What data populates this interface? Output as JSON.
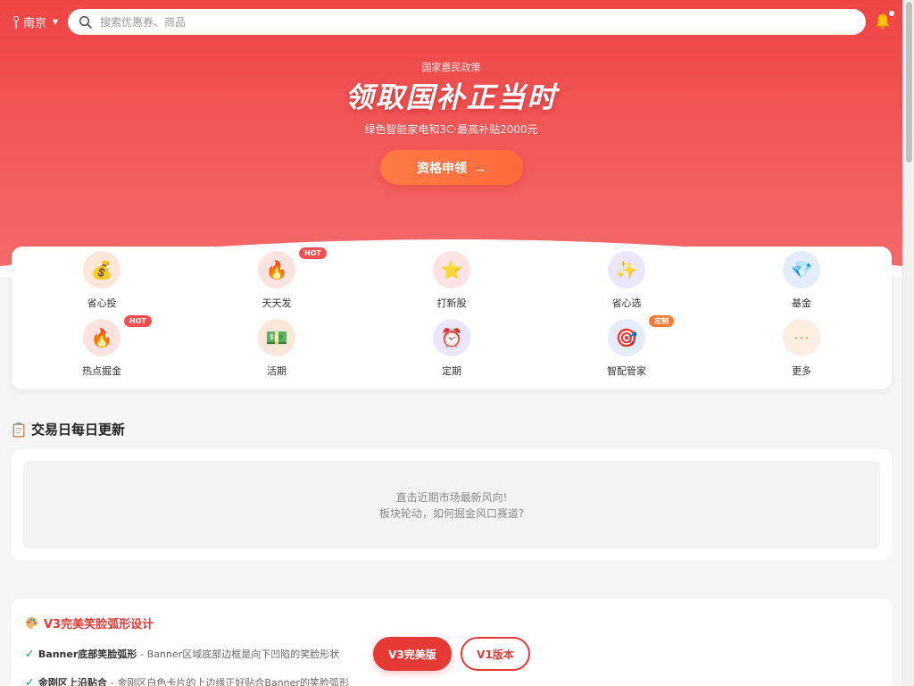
{
  "header": {
    "city": "南京",
    "search_placeholder": "搜索优惠券、商品"
  },
  "hero": {
    "kicker": "国家惠民政策",
    "title": "领取国补正当时",
    "desc": "绿色智能家电和3C·最高补贴2000元",
    "cta_label": "资格申领",
    "cta_arrow": "→"
  },
  "grid": {
    "items": [
      {
        "label": "省心投",
        "icon": "money-bag-icon",
        "glyph": "💰",
        "bg": "#fde7d8"
      },
      {
        "label": "天天发",
        "icon": "fire-icon",
        "glyph": "🔥",
        "bg": "#fde3df",
        "badge": "HOT"
      },
      {
        "label": "打新股",
        "icon": "star-icon",
        "glyph": "⭐",
        "bg": "#fde2e6"
      },
      {
        "label": "省心选",
        "icon": "sparkles-icon",
        "glyph": "✨",
        "bg": "#ece6fb"
      },
      {
        "label": "基金",
        "icon": "gem-icon",
        "glyph": "💎",
        "bg": "#e4ebfb"
      },
      {
        "label": "热点掘金",
        "icon": "fire-icon",
        "glyph": "🔥",
        "bg": "#fde3df",
        "badge": "HOT"
      },
      {
        "label": "活期",
        "icon": "cash-icon",
        "glyph": "💵",
        "bg": "#fde7d8"
      },
      {
        "label": "定期",
        "icon": "alarm-clock-icon",
        "glyph": "⏰",
        "bg": "#ece6fb"
      },
      {
        "label": "智配管家",
        "icon": "target-icon",
        "glyph": "🎯",
        "bg": "#e4ebfb",
        "badge": "定制"
      },
      {
        "label": "更多",
        "icon": "more-icon",
        "glyph": "⋯",
        "bg": "#fdeee2"
      }
    ]
  },
  "daily": {
    "title": "交易日每日更新",
    "line1": "直击近期市场最新风向!",
    "line2": "板块轮动，如何掘金风口赛道?"
  },
  "notes": {
    "title": "V3完美笑脸弧形设计",
    "rows": [
      {
        "strong": "Banner底部笑脸弧形",
        "text": "- Banner区域底部边框是向下凹陷的笑脸形状"
      },
      {
        "strong": "金刚区上沿贴合",
        "text": "- 金刚区白色卡片的上边缘正好贴合Banner的笑脸弧形"
      }
    ],
    "btn_primary": "V3完美版",
    "btn_secondary": "V1版本"
  },
  "colors": {
    "brand_red": "#ef4444",
    "cta_orange": "#ff7a45",
    "accent_red": "#e53935",
    "check_green": "#22a34a"
  }
}
